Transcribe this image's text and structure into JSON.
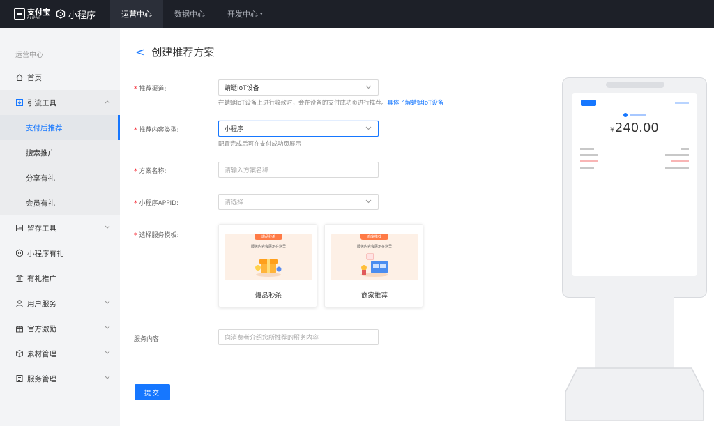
{
  "topbar": {
    "brand_alipay": "支付宝",
    "brand_alipay_en": "ALIPAY",
    "brand_mini": "小程序",
    "nav": [
      {
        "label": "运营中心",
        "active": true
      },
      {
        "label": "数据中心",
        "active": false
      },
      {
        "label": "开发中心",
        "active": false,
        "dropdown": true
      }
    ],
    "caret": "▾"
  },
  "sidebar": {
    "section_title": "运营中心",
    "items": {
      "home": "首页",
      "traffic_tools": "引流工具",
      "sub_after_pay": "支付后推荐",
      "sub_search": "搜索推广",
      "sub_share": "分享有礼",
      "sub_member": "会员有礼",
      "retention_tools": "留存工具",
      "mini_gift": "小程序有礼",
      "gift_promo": "有礼推广",
      "user_service": "用户服务",
      "official_incentive": "官方激励",
      "material_mgmt": "素材管理",
      "service_mgmt": "服务管理"
    }
  },
  "page": {
    "back": "<",
    "title": "创建推荐方案"
  },
  "form": {
    "channel": {
      "label": "推荐渠道:",
      "value": "蜻蜓IoT设备",
      "hint_prefix": "在蜻蜓IoT设备上进行收款时，会在设备的支付成功页进行推荐。",
      "hint_link": "具体了解蜻蜓IoT设备"
    },
    "content_type": {
      "label": "推荐内容类型:",
      "value": "小程序",
      "hint": "配置完成后可在支付成功页展示"
    },
    "plan_name": {
      "label": "方案名称:",
      "placeholder": "请输入方案名称"
    },
    "appid": {
      "label": "小程序APPID:",
      "placeholder": "请选择"
    },
    "template": {
      "label": "选择服务模板:",
      "cards": [
        {
          "tag": "爆品秒杀",
          "line": "服务内容会展示在这里",
          "name": "爆品秒杀"
        },
        {
          "tag": "商家推荐",
          "line": "服务内容会展示在这里",
          "name": "商家推荐"
        }
      ]
    },
    "service_content": {
      "label": "服务内容:",
      "placeholder": "向消费者介绍您所推荐的服务内容"
    },
    "required_mark": "*",
    "submit": "提交"
  },
  "preview": {
    "amount": "240.00",
    "currency": "¥"
  },
  "colors": {
    "accent": "#1677ff",
    "topbar_bg": "#1d2028",
    "sidebar_bg": "#f3f4f6",
    "required": "#f5222d"
  }
}
